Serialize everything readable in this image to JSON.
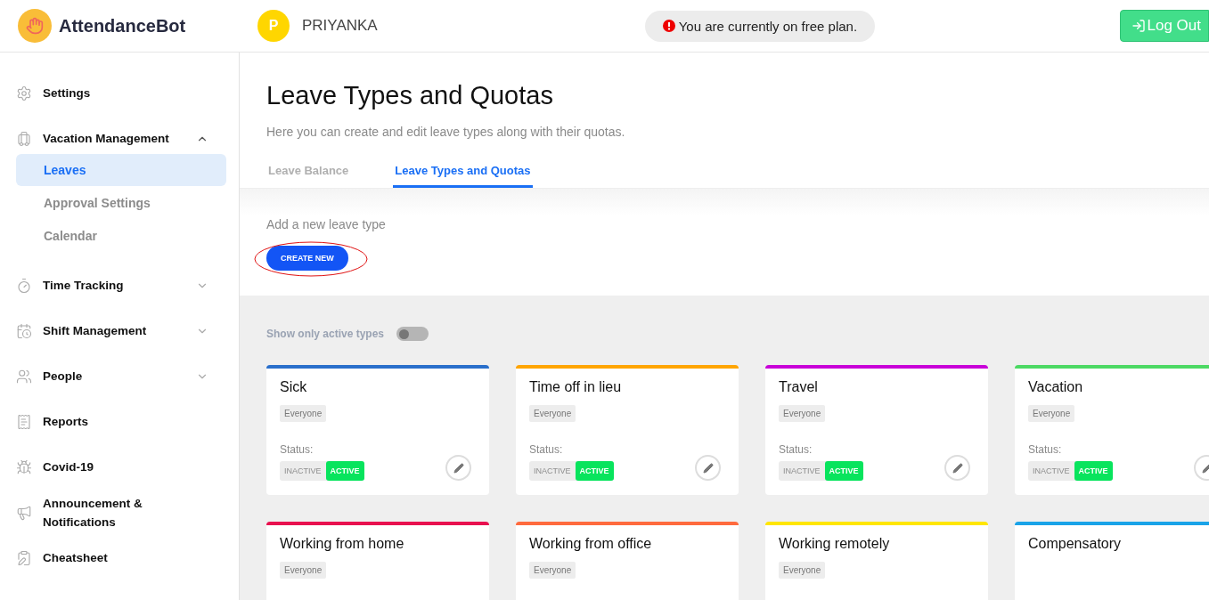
{
  "header": {
    "brand": "AttendanceBot",
    "user": {
      "initial": "P",
      "name": "PRIYANKA"
    },
    "notice": "You are currently on free plan.",
    "logout": "Log Out"
  },
  "sidebar": {
    "items": [
      {
        "label": "Settings"
      },
      {
        "label": "Vacation Management",
        "expanded": true,
        "children": [
          {
            "label": "Leaves",
            "selected": true
          },
          {
            "label": "Approval Settings",
            "selected": false
          },
          {
            "label": "Calendar",
            "selected": false
          }
        ]
      },
      {
        "label": "Time Tracking",
        "expanded": false
      },
      {
        "label": "Shift Management",
        "expanded": false
      },
      {
        "label": "People",
        "expanded": false
      },
      {
        "label": "Reports"
      },
      {
        "label": "Covid-19"
      },
      {
        "label": "Announcement & Notifications"
      },
      {
        "label": "Cheatsheet"
      }
    ]
  },
  "page": {
    "title": "Leave Types and Quotas",
    "subtitle": "Here you can create and edit leave types along with their quotas.",
    "tabs": [
      {
        "label": "Leave Balance",
        "selected": false
      },
      {
        "label": "Leave Types and Quotas",
        "selected": true
      }
    ],
    "create": {
      "label": "Add a new leave type",
      "button": "CREATE NEW"
    },
    "filter": {
      "label": "Show only active types",
      "on": false
    },
    "leave_types": [
      {
        "name": "Sick",
        "color": "#2a6fcb",
        "audience": "Everyone",
        "status_label": "Status:",
        "inactive": "INACTIVE",
        "active": "ACTIVE",
        "is_active": true
      },
      {
        "name": "Time off in lieu",
        "color": "#ffa500",
        "audience": "Everyone",
        "status_label": "Status:",
        "inactive": "INACTIVE",
        "active": "ACTIVE",
        "is_active": true
      },
      {
        "name": "Travel",
        "color": "#c800d8",
        "audience": "Everyone",
        "status_label": "Status:",
        "inactive": "INACTIVE",
        "active": "ACTIVE",
        "is_active": true
      },
      {
        "name": "Vacation",
        "color": "#4cd964",
        "audience": "Everyone",
        "status_label": "Status:",
        "inactive": "INACTIVE",
        "active": "ACTIVE",
        "is_active": true
      },
      {
        "name": "Working from home",
        "color": "#e8104f",
        "audience": "Everyone"
      },
      {
        "name": "Working from office",
        "color": "#ff6a3d",
        "audience": "Everyone"
      },
      {
        "name": "Working remotely",
        "color": "#ffe600",
        "audience": "Everyone"
      },
      {
        "name": "Compensatory",
        "color": "#1aa3e8"
      }
    ]
  }
}
